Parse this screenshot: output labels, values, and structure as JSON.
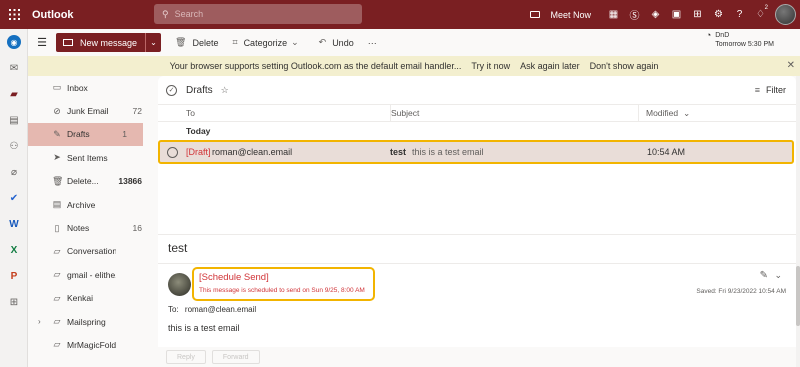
{
  "app": {
    "title": "Outlook"
  },
  "search": {
    "placeholder": "Search"
  },
  "topbar": {
    "meet_now": "Meet Now",
    "notification_count": "2",
    "icons": [
      "calendar-grid-icon",
      "skype-icon",
      "diamond-icon",
      "office-icon",
      "teams-icon",
      "gear-icon",
      "help-icon",
      "megaphone-icon"
    ]
  },
  "commands": {
    "new_message": "New message",
    "delete": "Delete",
    "categorize": "Categorize",
    "undo": "Undo",
    "more": "···",
    "dnd_title": "DnD",
    "dnd_time": "Tomorrow 5:30 PM"
  },
  "infobar": {
    "message": "Your browser supports setting Outlook.com as the default email handler...",
    "try": "Try it now",
    "later": "Ask again later",
    "dont": "Don't show again"
  },
  "folders": [
    {
      "name": "Inbox",
      "count": "",
      "icon": "inbox-icon",
      "bold": false,
      "selected": false,
      "chevron": false
    },
    {
      "name": "Junk Email",
      "count": "72",
      "icon": "junk-icon",
      "bold": false,
      "selected": false,
      "chevron": false
    },
    {
      "name": "Drafts",
      "count": "1",
      "icon": "pencil-icon",
      "bold": false,
      "selected": true,
      "chevron": false
    },
    {
      "name": "Sent Items",
      "count": "",
      "icon": "send-icon",
      "bold": false,
      "selected": false,
      "chevron": false
    },
    {
      "name": "Delete...",
      "count": "13866",
      "icon": "trash-icon",
      "bold": true,
      "selected": false,
      "chevron": false
    },
    {
      "name": "Archive",
      "count": "",
      "icon": "archive-icon",
      "bold": false,
      "selected": false,
      "chevron": false
    },
    {
      "name": "Notes",
      "count": "16",
      "icon": "note-icon",
      "bold": false,
      "selected": false,
      "chevron": false
    },
    {
      "name": "Conversation ...",
      "count": "",
      "icon": "folder-icon",
      "bold": false,
      "selected": false,
      "chevron": false
    },
    {
      "name": "gmail - elithe...",
      "count": "",
      "icon": "folder-icon",
      "bold": false,
      "selected": false,
      "chevron": false
    },
    {
      "name": "Kenkai",
      "count": "",
      "icon": "folder-icon",
      "bold": false,
      "selected": false,
      "chevron": false
    },
    {
      "name": "Mailspring",
      "count": "",
      "icon": "folder-icon",
      "bold": false,
      "selected": false,
      "chevron": true
    },
    {
      "name": "MrMagicFolder",
      "count": "",
      "icon": "folder-icon",
      "bold": false,
      "selected": false,
      "chevron": false
    }
  ],
  "list": {
    "title": "Drafts",
    "filter": "Filter",
    "col_to": "To",
    "col_subject": "Subject",
    "col_modified": "Modified",
    "group": "Today",
    "rows": [
      {
        "draft_tag": "[Draft]",
        "to": "roman@clean.email",
        "subject": "test",
        "preview": "this is a test email",
        "time": "10:54 AM"
      }
    ]
  },
  "reading": {
    "subject": "test",
    "schedule_title": "[Schedule Send]",
    "schedule_note": "This message is scheduled to send on Sun 9/25, 8:00 AM",
    "saved": "Saved: Fri 9/23/2022 10:54 AM",
    "to_label": "To:",
    "to": "roman@clean.email",
    "body": "this is a test email"
  },
  "footer": {
    "reply": "Reply",
    "forward": "Forward"
  },
  "colors": {
    "brand": "#7a1f22",
    "selected_folder": "#e5b8b0",
    "highlight": "#f2b400",
    "draft_red": "#d13438"
  }
}
